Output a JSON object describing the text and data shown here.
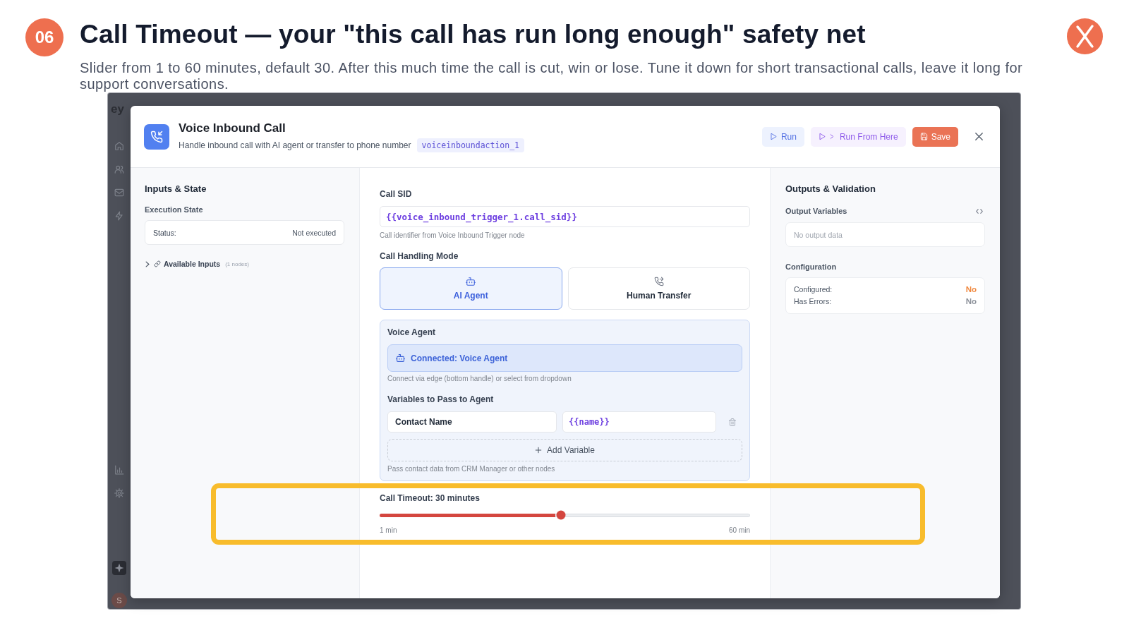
{
  "slide": {
    "step": "06",
    "title": "Call Timeout — your \"this call has run long enough\" safety net",
    "subtitle": "Slider from 1 to 60 minutes, default 30. After this much time the call is cut, win or lose. Tune it down for short transactional calls, leave it long for support conversations."
  },
  "backdrop": {
    "logo_text": "ey",
    "avatar_initial": "S"
  },
  "dialog": {
    "title": "Voice Inbound Call",
    "description": "Handle inbound call with AI agent or transfer to phone number",
    "node_id": "voiceinboundaction_1",
    "actions": [
      {
        "kind": "run",
        "label": "Run"
      },
      {
        "kind": "run_from_here",
        "label": "Run From Here"
      },
      {
        "kind": "save",
        "label": "Save"
      }
    ]
  },
  "inputs_panel": {
    "title": "Inputs & State",
    "section": "Execution State",
    "status_label": "Status:",
    "status_value": "Not executed",
    "available_inputs": {
      "label": "Available Inputs",
      "count": "(1 nodes)",
      "expanded": false
    }
  },
  "config_panel": {
    "call_sid": {
      "label": "Call SID",
      "value": "{{voice_inbound_trigger_1.call_sid}}",
      "hint": "Call identifier from Voice Inbound Trigger node"
    },
    "mode": {
      "label": "Call Handling Mode",
      "options": [
        {
          "kind": "ai_agent",
          "label": "AI Agent",
          "selected": true
        },
        {
          "kind": "human_transfer",
          "label": "Human Transfer",
          "selected": false
        }
      ]
    },
    "voice_agent": {
      "label": "Voice Agent",
      "connection": "Connected: Voice Agent",
      "hint": "Connect via edge (bottom handle) or select from dropdown"
    },
    "variables": {
      "label": "Variables to Pass to Agent",
      "rows": [
        {
          "name": "Contact Name",
          "value": "{{name}}"
        }
      ],
      "add_label": "Add Variable",
      "hint": "Pass contact data from CRM Manager or other nodes"
    },
    "timeout": {
      "label": "Call Timeout: 30 minutes",
      "level": 0.49,
      "min_label": "1 min",
      "max_label": "60 min"
    }
  },
  "outputs_panel": {
    "title": "Outputs & Validation",
    "variables_label": "Output Variables",
    "empty_text": "No output data",
    "config_label": "Configuration",
    "checks": [
      {
        "label": "Configured:",
        "value": "No",
        "color": "#f0883e"
      },
      {
        "label": "Has Errors:",
        "value": "No",
        "color": "#8b9099"
      }
    ]
  }
}
